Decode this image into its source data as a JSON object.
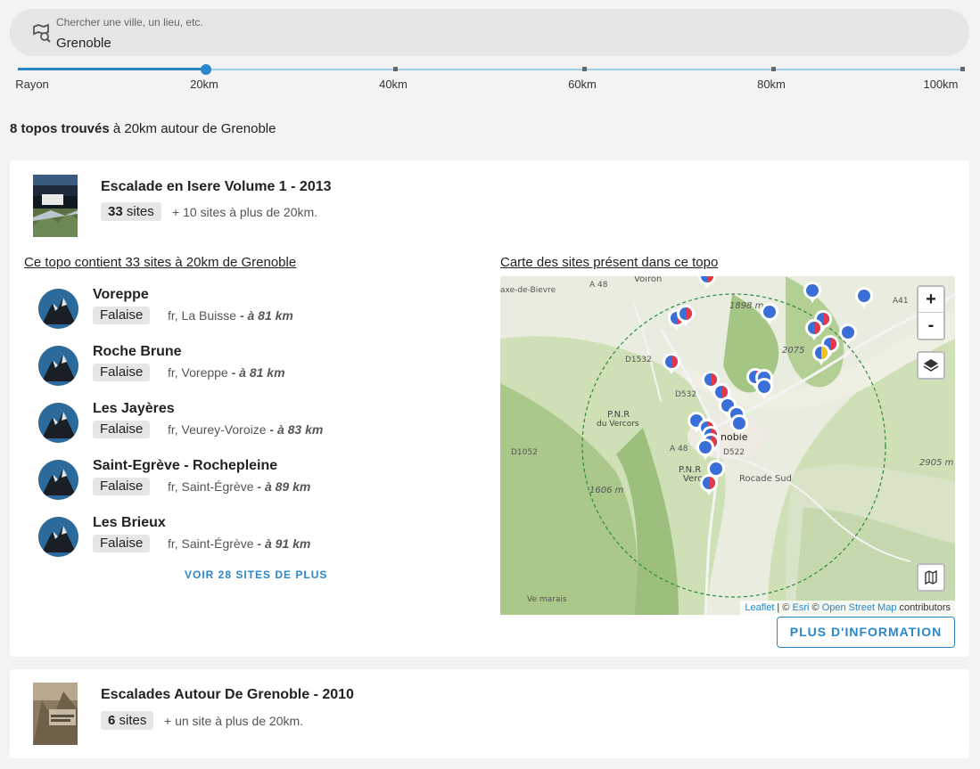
{
  "search": {
    "label": "Chercher une ville, un lieu, etc.",
    "value": "Grenoble",
    "icon": "map-search-icon"
  },
  "slider": {
    "label": "Rayon",
    "marks": [
      "20km",
      "40km",
      "60km",
      "80km",
      "100km"
    ],
    "value_km": 20,
    "max_km": 100
  },
  "results": {
    "count_text": "8 topos trouvés",
    "suffix": " à 20km autour de Grenoble"
  },
  "topos": [
    {
      "title": "Escalade en Isere Volume 1 - 2013",
      "sites_count": "33",
      "sites_word": "sites",
      "extra": "+ 10 sites à plus de 20km.",
      "sites_link": "Ce topo contient 33 sites à 20km de Grenoble",
      "map_link": "Carte des sites présent dans ce topo",
      "sites": [
        {
          "name": "Voreppe",
          "type": "Falaise",
          "location": "fr, La Buisse",
          "distance": "- à 81 km"
        },
        {
          "name": "Roche Brune",
          "type": "Falaise",
          "location": "fr, Voreppe",
          "distance": "- à 81 km"
        },
        {
          "name": "Les Jayères",
          "type": "Falaise",
          "location": "fr, Veurey-Voroize",
          "distance": "- à 83 km"
        },
        {
          "name": "Saint-Egrève - Rochepleine",
          "type": "Falaise",
          "location": "fr, Saint-Égrève",
          "distance": "- à 89 km"
        },
        {
          "name": "Les Brieux",
          "type": "Falaise",
          "location": "fr, Saint-Égrève",
          "distance": "- à 91 km"
        }
      ],
      "more_sites": "VOIR 28 SITES DE PLUS",
      "more_info": "PLUS D'INFORMATION"
    },
    {
      "title": "Escalades Autour De Grenoble - 2010",
      "sites_count": "6",
      "sites_word": "sites",
      "extra": "+ un site à plus de 20km."
    }
  ],
  "map": {
    "zoom_in": "+",
    "zoom_out": "-",
    "attribution": {
      "leaflet": "Leaflet",
      "sep1": " | © ",
      "esri": "Esri",
      "sep2": " © ",
      "osm": "Open Street Map",
      "tail": " contributors"
    },
    "labels": {
      "voiron": "Voiron",
      "a48": "A 48",
      "aixe": "axe-de-Bievre",
      "m1898": "1898 m",
      "m2075": "2075",
      "a41": "A41",
      "d1532": "D1532",
      "d532": "D532",
      "pnr": "P.N.R",
      "vercors": "du Vercors",
      "d1052": "D1052",
      "a48b": "A 48",
      "pnr2": "P.N.R",
      "verc2": "Verc",
      "d522": "D522",
      "rocade": "Rocade Sud",
      "m1606": "1606 m",
      "m2905": "2905 m",
      "grenoble": "noble",
      "marais": "Ve marais"
    },
    "colors": {
      "marker_blue": "#3a6fd8",
      "marker_red": "#e2384a",
      "marker_yellow": "#f0c419",
      "circle": "#2e8b3a"
    }
  }
}
